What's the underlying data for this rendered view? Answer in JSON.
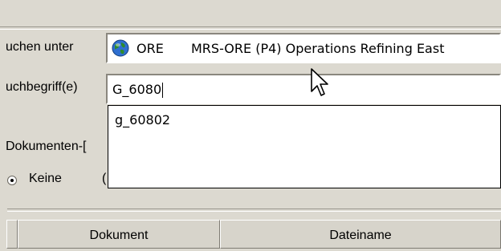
{
  "search_in": {
    "label": "uchen unter",
    "icon": "globe-icon",
    "code": "ORE",
    "description": "MRS-ORE (P4) Operations Refining East"
  },
  "search_term": {
    "label": "uchbegriff(e)",
    "value": "G_6080",
    "suggestions": [
      "g_60802"
    ]
  },
  "document_type": {
    "label": "Dokumenten-[",
    "radio_keine_label": "Keine",
    "radio_second_partial": "("
  },
  "results_table": {
    "columns": [
      "Dokument",
      "Dateiname"
    ]
  },
  "colors": {
    "dialog_bg": "#dcd9d0",
    "field_bg": "#ffffff"
  }
}
